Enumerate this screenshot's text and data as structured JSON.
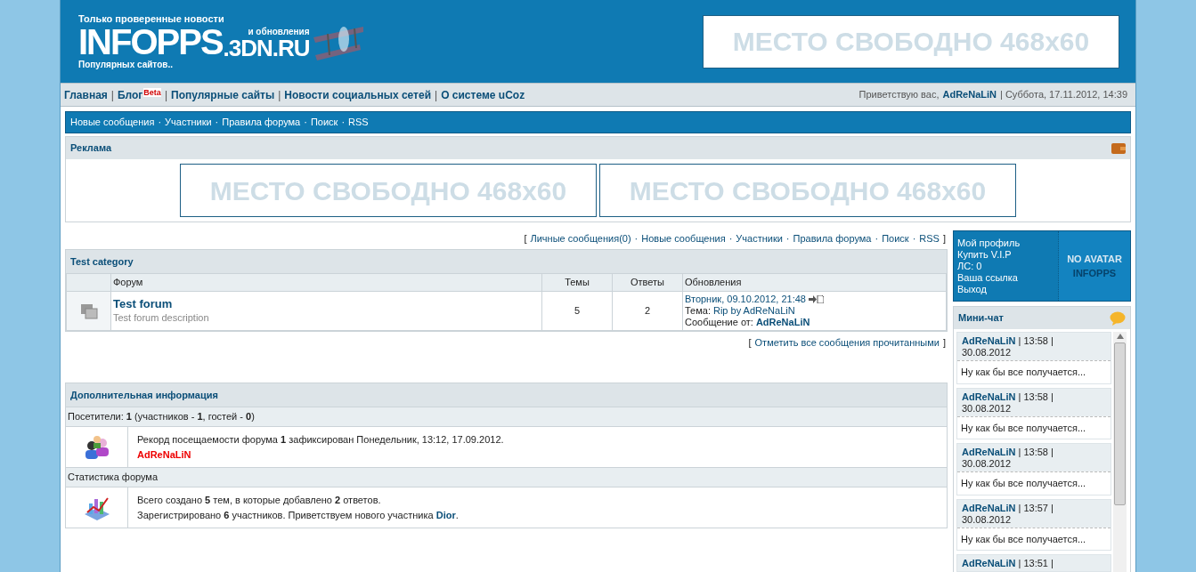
{
  "header": {
    "logo": {
      "tagline_top": "Только проверенные новости",
      "name": "INFOPPS",
      "domain": ".3DN.RU",
      "tagline_side": "и обновления",
      "tagline_bottom": "Популярных сайтов.."
    },
    "banner": "МЕСТО СВОБОДНО 468x60"
  },
  "nav": {
    "separator": "|",
    "items": [
      {
        "label": "Главная"
      },
      {
        "label": "Блог",
        "badge": "Beta"
      },
      {
        "label": "Популярные сайты"
      },
      {
        "label": "Новости социальных сетей"
      },
      {
        "label": "О системе uCoz"
      }
    ],
    "greeting": "Приветствую вас,",
    "user": "AdReNaLiN",
    "date": "Суббота, 17.11.2012, 14:39"
  },
  "forum_bar": {
    "separator": "·",
    "items": [
      "Новые сообщения",
      "Участники",
      "Правила форума",
      "Поиск",
      "RSS"
    ]
  },
  "ads": {
    "title": "Реклама",
    "banners": [
      "МЕСТО СВОБОДНО 468x60",
      "МЕСТО СВОБОДНО 468x60"
    ]
  },
  "links_bar": {
    "open": "[",
    "close": "]",
    "separator": "·",
    "items": [
      "Личные сообщения(0)",
      "Новые сообщения",
      "Участники",
      "Правила форума",
      "Поиск",
      "RSS"
    ]
  },
  "category": {
    "title": "Test category",
    "columns": [
      "Форум",
      "Темы",
      "Ответы",
      "Обновления"
    ],
    "rows": [
      {
        "name": "Test forum",
        "description": "Test forum description",
        "topics": "5",
        "replies": "2",
        "last_date": "Вторник, 09.10.2012, 21:48",
        "topic_label": "Тема:",
        "topic": "Rip by AdReNaLiN",
        "author_label": "Сообщение от:",
        "author": "AdReNaLiN"
      }
    ]
  },
  "mark_read": {
    "open": "[",
    "label": "Отметить все сообщения прочитанными",
    "close": "]"
  },
  "info": {
    "title": "Дополнительная информация",
    "visitors": "Посетители: **1**  (участников - **1**, гостей - **0**)",
    "record": "Рекорд посещаемости форума **1** зафиксирован Понедельник, 13:12, 17.09.2012.",
    "record_user": "AdReNaLiN",
    "stats_title": "Статистика форума",
    "stats_line1": "Всего создано **5** тем, в которые добавлено **2** ответов.",
    "stats_line2": "Зарегистрировано **6** участников. Приветствуем нового участника",
    "new_member": "Dior",
    "stats_end": "."
  },
  "profile": {
    "links": [
      "Мой профиль",
      "Купить V.I.P",
      "ЛС: 0",
      "Ваша ссылка",
      "Выход"
    ],
    "avatar_top": "NO AVATAR",
    "avatar_bottom": "INFOPPS"
  },
  "minichat": {
    "title": "Мини-чат",
    "messages": [
      {
        "author": "AdReNaLiN",
        "time": "| 13:58 |",
        "date": "30.08.2012",
        "text": "Ну как бы все получается..."
      },
      {
        "author": "AdReNaLiN",
        "time": "| 13:58 |",
        "date": "30.08.2012",
        "text": "Ну как бы все получается..."
      },
      {
        "author": "AdReNaLiN",
        "time": "| 13:58 |",
        "date": "30.08.2012",
        "text": "Ну как бы все получается..."
      },
      {
        "author": "AdReNaLiN",
        "time": "| 13:57 |",
        "date": "30.08.2012",
        "text": "Ну как бы все получается..."
      },
      {
        "author": "AdReNaLiN",
        "time": "| 13:51 |"
      }
    ]
  }
}
